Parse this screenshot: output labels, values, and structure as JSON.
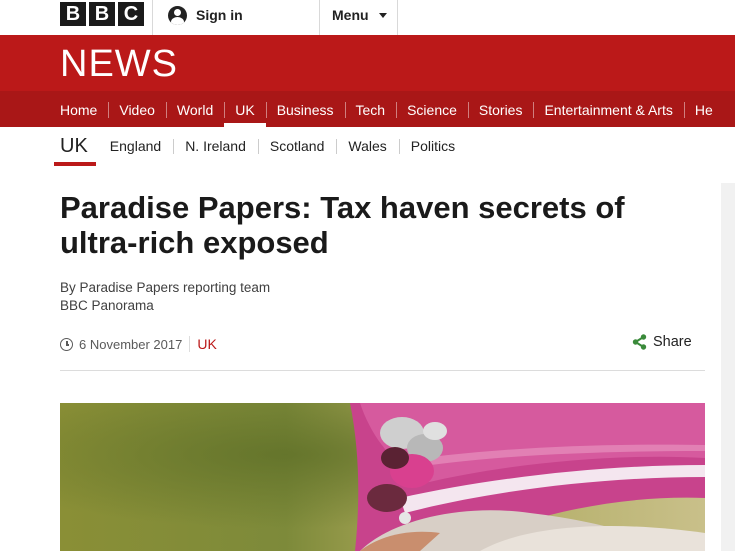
{
  "brand": {
    "logo_letters": [
      "B",
      "B",
      "C"
    ],
    "news_logo": "NEWS"
  },
  "topbar": {
    "sign_in_label": "Sign in",
    "menu_label": "Menu"
  },
  "nav": {
    "items": [
      {
        "label": "Home"
      },
      {
        "label": "Video"
      },
      {
        "label": "World"
      },
      {
        "label": "UK"
      },
      {
        "label": "Business"
      },
      {
        "label": "Tech"
      },
      {
        "label": "Science"
      },
      {
        "label": "Stories"
      },
      {
        "label": "Entertainment & Arts"
      },
      {
        "label": "He"
      }
    ],
    "active": "UK"
  },
  "subnav": {
    "title": "UK",
    "items": [
      {
        "label": "England"
      },
      {
        "label": "N. Ireland"
      },
      {
        "label": "Scotland"
      },
      {
        "label": "Wales"
      },
      {
        "label": "Politics"
      }
    ]
  },
  "article": {
    "headline": "Paradise Papers: Tax haven secrets of ultra-rich exposed",
    "byline_author": "By Paradise Papers reporting team",
    "byline_org": "BBC Panorama",
    "date": "6 November 2017",
    "section_link": "UK",
    "share_label": "Share"
  },
  "colors": {
    "brand_red": "#bb1919",
    "nav_red": "#a91717",
    "share_green": "#3a8a3a"
  },
  "icons": {
    "account": "user-avatar-icon",
    "menu": "chevron-down-icon",
    "clock": "clock-icon",
    "share": "share-icon"
  }
}
